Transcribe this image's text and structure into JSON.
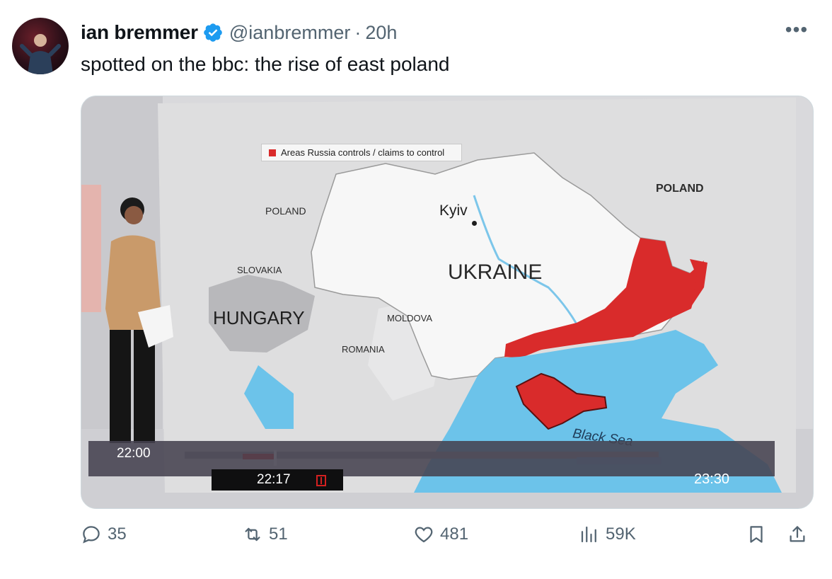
{
  "tweet": {
    "author_name": "ian bremmer",
    "handle": "@ianbremmer",
    "time": "20h",
    "separator": "·",
    "text": "spotted on the bbc: the rise of east poland",
    "more_label": "•••"
  },
  "media": {
    "legend": "Areas Russia controls  /  claims to control",
    "labels": {
      "poland_left": "POLAND",
      "poland_right": "POLAND",
      "slovakia": "SLOVAKIA",
      "hungary": "HUNGARY",
      "moldova": "MOLDOVA",
      "romania": "ROMANIA",
      "ukraine": "UKRAINE",
      "kyiv": "Kyiv",
      "black_sea": "Black Sea"
    },
    "timeline": {
      "start": "22:00",
      "current": "22:17",
      "end": "23:30"
    }
  },
  "actions": {
    "replies": "35",
    "reposts": "51",
    "likes": "481",
    "views": "59K"
  },
  "colors": {
    "verified": "#1d9bf0",
    "russia_area": "#d92b2b",
    "sea": "#6cc3ea",
    "muted_text": "#536471"
  }
}
